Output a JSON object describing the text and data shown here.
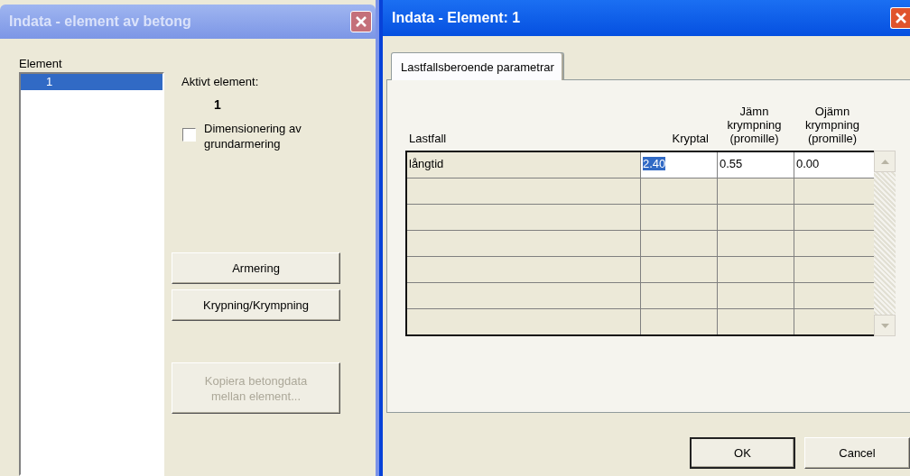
{
  "windows": [
    {
      "title": "Indata - element av betong",
      "active": false,
      "list_label": "Element",
      "list_items": [
        {
          "label": "1",
          "selected": true
        }
      ],
      "active_label": "Aktivt element:",
      "active_value": "1",
      "checkbox": {
        "label": "Dimensionering av grundarmering",
        "checked": false
      },
      "buttons": [
        {
          "label": "Armering",
          "disabled": false
        },
        {
          "label": "Krypning/Krympning",
          "disabled": false
        },
        {
          "label": "Kopiera betongdata mellan element...",
          "disabled": true
        }
      ]
    },
    {
      "title": "Indata - Element: 1",
      "active": true,
      "tabs": [
        {
          "label": "Lastfallsberoende parametrar",
          "selected": true
        }
      ],
      "table": {
        "columns": [
          "Lastfall",
          "Kryptal",
          "Jämn krympning (promille)",
          "Ojämn krympning (promille)"
        ],
        "rows": [
          {
            "cells": [
              {
                "kind": "label",
                "text": "långtid",
                "selected": false
              },
              {
                "kind": "input",
                "text": "2.40",
                "selected": true
              },
              {
                "kind": "input",
                "text": "0.55",
                "selected": false
              },
              {
                "kind": "input",
                "text": "0.00",
                "selected": false
              }
            ]
          }
        ]
      },
      "buttons": [
        {
          "label": "OK",
          "default": true
        },
        {
          "label": "Cancel",
          "default": false
        }
      ]
    }
  ]
}
